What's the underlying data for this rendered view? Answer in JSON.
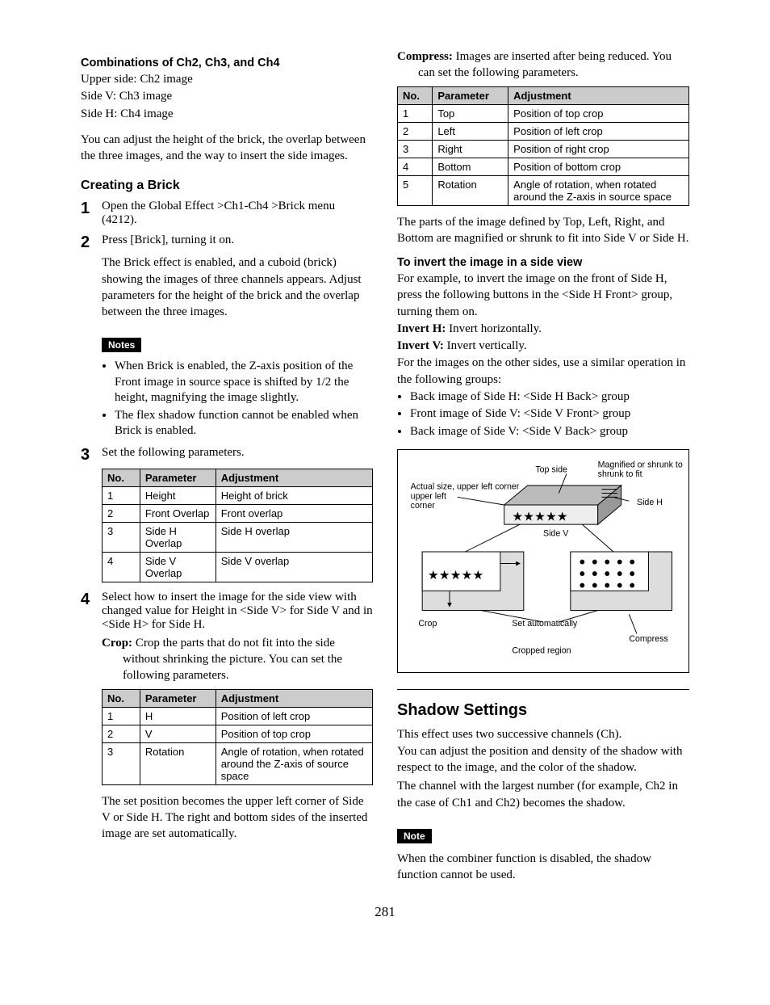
{
  "left": {
    "combo_head": "Combinations of Ch2, Ch3, and Ch4",
    "combo_l1": "Upper side: Ch2 image",
    "combo_l2": "Side V: Ch3 image",
    "combo_l3": "Side H: Ch4 image",
    "combo_p": "You can adjust the height of the brick, the overlap between the three images, and the way to insert the side images.",
    "create_head": "Creating a Brick",
    "step1": "Open the Global Effect >Ch1-Ch4 >Brick menu (4212).",
    "step2a": "Press [Brick], turning it on.",
    "step2b": "The Brick effect is enabled, and a cuboid (brick) showing the images of three channels appears. Adjust parameters for the height of the brick and the overlap between the three images.",
    "notes_label": "Notes",
    "note1": "When Brick is enabled, the Z-axis position of the Front image in source space is shifted by 1/2 the height, magnifying the image slightly.",
    "note2": "The flex shadow function cannot be enabled when Brick is enabled.",
    "step3": "Set the following parameters.",
    "table1": {
      "h1": "No.",
      "h2": "Parameter",
      "h3": "Adjustment",
      "rows": [
        {
          "n": "1",
          "p": "Height",
          "a": "Height of brick"
        },
        {
          "n": "2",
          "p": "Front Overlap",
          "a": "Front overlap"
        },
        {
          "n": "3",
          "p": "Side H Overlap",
          "a": "Side H overlap"
        },
        {
          "n": "4",
          "p": "Side V Overlap",
          "a": "Side V overlap"
        }
      ]
    },
    "step4": "Select how to insert the image for the side view with changed value for Height in <Side V> for Side V and in <Side H> for Side H.",
    "crop_label": "Crop:",
    "crop_text": " Crop the parts that do not fit into the side without shrinking the picture. You can set the following parameters.",
    "table2": {
      "h1": "No.",
      "h2": "Parameter",
      "h3": "Adjustment",
      "rows": [
        {
          "n": "1",
          "p": "H",
          "a": "Position of left crop"
        },
        {
          "n": "2",
          "p": "V",
          "a": "Position of top crop"
        },
        {
          "n": "3",
          "p": "Rotation",
          "a": "Angle of rotation, when rotated around the Z-axis of source space"
        }
      ]
    },
    "after_t2": "The set position becomes the upper left corner of Side V or Side H. The right and bottom sides of the inserted image are set automatically."
  },
  "right": {
    "compress_label": "Compress:",
    "compress_text": " Images are inserted after being reduced. You can set the following parameters.",
    "table3": {
      "h1": "No.",
      "h2": "Parameter",
      "h3": "Adjustment",
      "rows": [
        {
          "n": "1",
          "p": "Top",
          "a": "Position of top crop"
        },
        {
          "n": "2",
          "p": "Left",
          "a": "Position of left crop"
        },
        {
          "n": "3",
          "p": "Right",
          "a": "Position of right crop"
        },
        {
          "n": "4",
          "p": "Bottom",
          "a": "Position of bottom crop"
        },
        {
          "n": "5",
          "p": "Rotation",
          "a": "Angle of rotation, when rotated around the Z-axis in source space"
        }
      ]
    },
    "after_t3": "The parts of the image defined by Top, Left, Right, and Bottom are magnified or shrunk to fit into Side V or Side H.",
    "invert_head": "To invert the image in a side view",
    "invert_p1": "For example, to invert the image on the front of Side H, press the following buttons in the <Side H Front> group, turning them on.",
    "inv_h_label": "Invert H:",
    "inv_h_text": " Invert horizontally.",
    "inv_v_label": "Invert V:",
    "inv_v_text": " Invert vertically.",
    "invert_p2": "For the images on the other sides, use a similar operation in the following groups:",
    "inv_b1": "Back image of Side H: <Side H Back> group",
    "inv_b2": "Front image of Side V: <Side V Front> group",
    "inv_b3": "Back image of Side V: <Side V Back> group",
    "diagram": {
      "top_side": "Top side",
      "magnified": "Magnified or shrunk to fit",
      "actual": "Actual size, upper left corner",
      "side_h": "Side H",
      "side_v": "Side V",
      "crop": "Crop",
      "set_auto": "Set automatically",
      "compress": "Compress",
      "cropped_region": "Cropped region"
    },
    "shadow_head": "Shadow Settings",
    "shadow_p1": "This effect uses two successive channels (Ch).",
    "shadow_p2": "You can adjust the position and density of the shadow with respect to the image, and the color of the shadow.",
    "shadow_p3": "The channel with the largest number (for example, Ch2 in the case of Ch1 and Ch2) becomes the shadow.",
    "note_label": "Note",
    "shadow_note": "When the combiner function is disabled, the shadow function cannot be used."
  },
  "page_number": "281"
}
